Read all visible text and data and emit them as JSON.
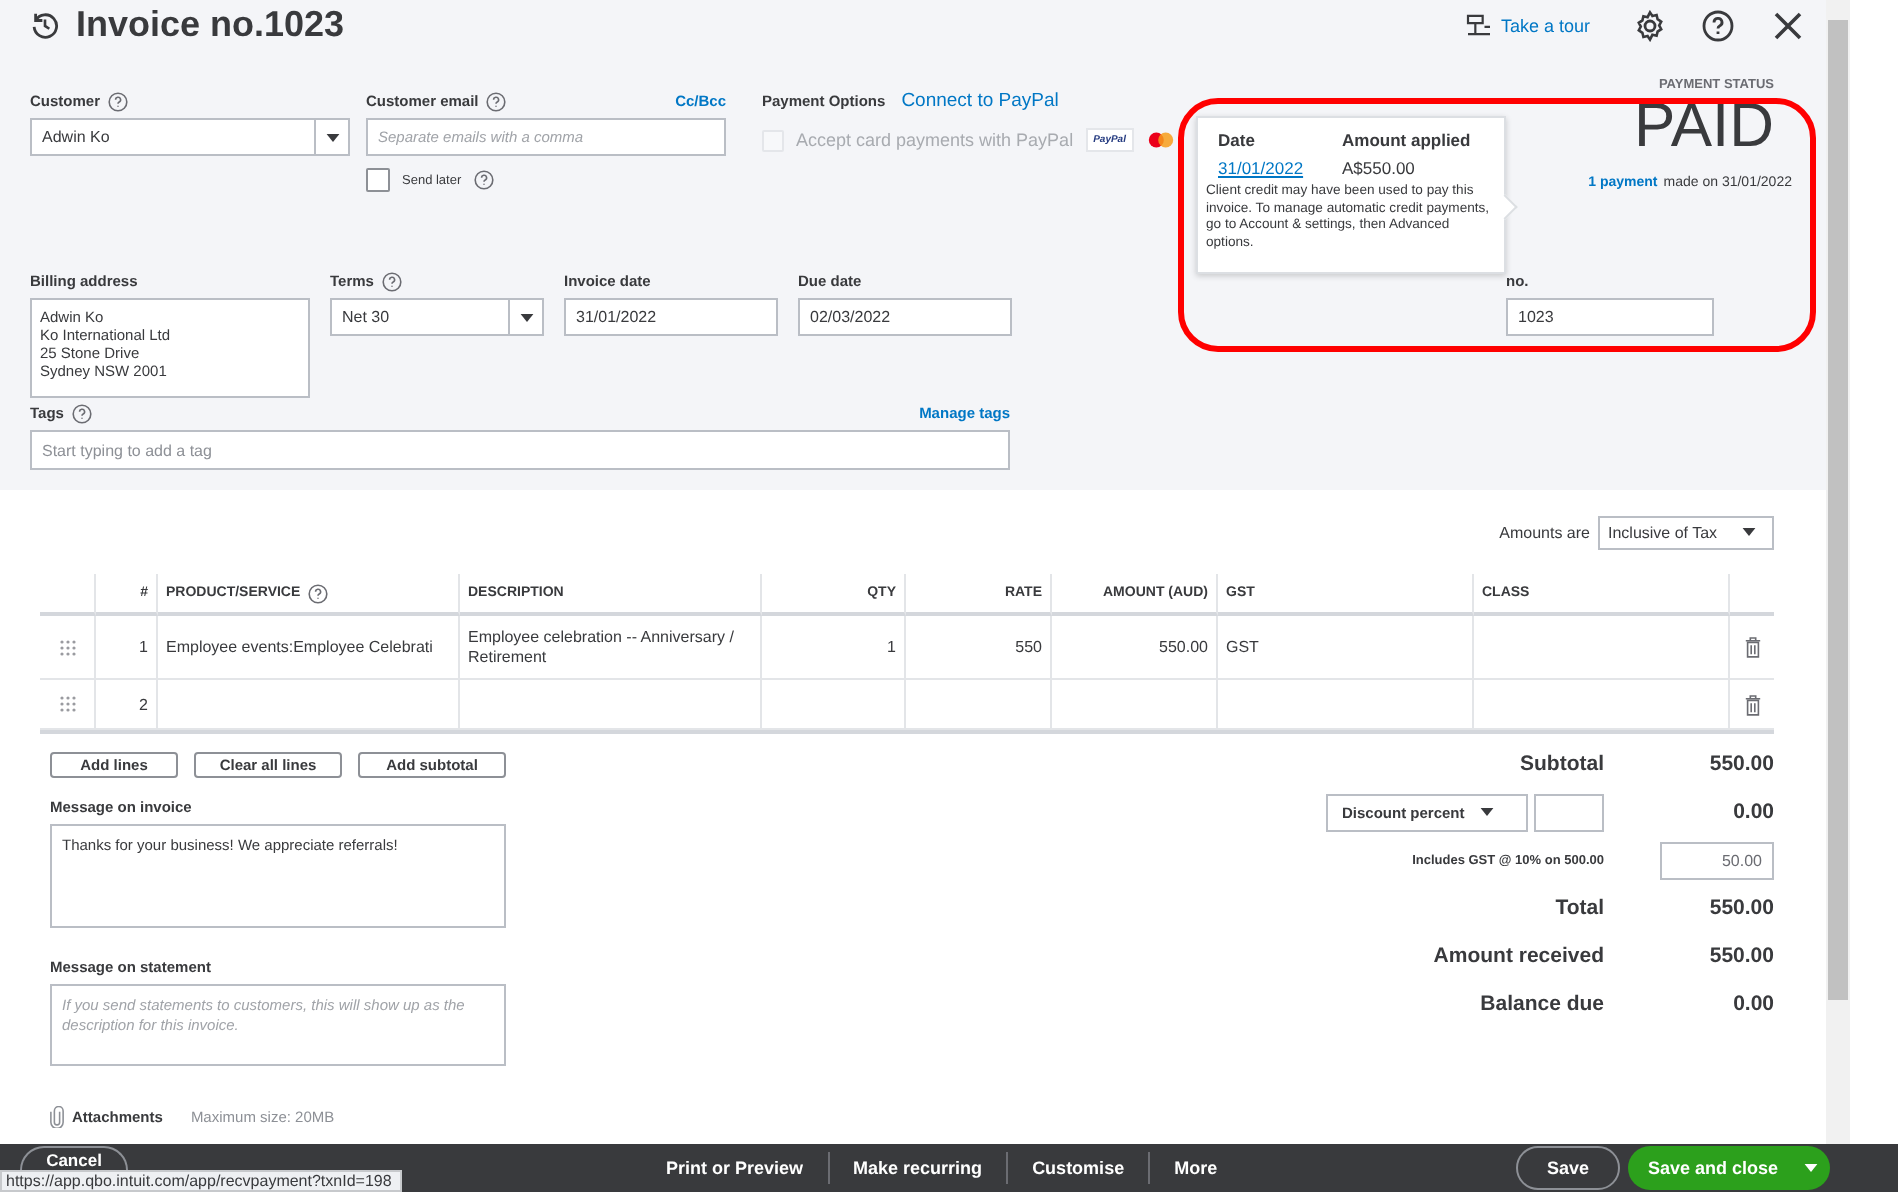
{
  "header": {
    "title": "Invoice no.1023",
    "tour_link": "Take a tour"
  },
  "customer": {
    "label": "Customer",
    "value": "Adwin Ko"
  },
  "customer_email": {
    "label": "Customer email",
    "placeholder": "Separate emails with a comma",
    "cc_link": "Cc/Bcc",
    "send_later": {
      "label": "Send later",
      "checked": false
    }
  },
  "payment_options": {
    "label": "Payment Options",
    "link": "Connect to PayPal",
    "accept_cards": {
      "label": "Accept card payments with PayPal",
      "checked": false,
      "disabled": true
    },
    "paypal_badge": "PayPal"
  },
  "payment_status": {
    "label": "PAYMENT STATUS",
    "status": "PAID",
    "payments_link": "1 payment",
    "payments_note": "made on 31/01/2022"
  },
  "payment_popup": {
    "columns": [
      "Date",
      "Amount applied"
    ],
    "date": "31/01/2022",
    "amount": "A$550.00",
    "note": "Client credit may have been used to pay this invoice. To manage automatic credit payments, go to Account & settings, then Advanced options."
  },
  "billing_address": {
    "label": "Billing address",
    "lines": [
      "Adwin Ko",
      "Ko International Ltd",
      "25 Stone Drive",
      "Sydney NSW  2001"
    ]
  },
  "terms": {
    "label": "Terms",
    "value": "Net 30"
  },
  "invoice_date": {
    "label": "Invoice date",
    "value": "31/01/2022"
  },
  "due_date": {
    "label": "Due date",
    "value": "02/03/2022"
  },
  "invoice_no": {
    "label": "no.",
    "value": "1023"
  },
  "tags": {
    "label": "Tags",
    "placeholder": "Start typing to add a tag",
    "manage_link": "Manage tags"
  },
  "amounts_are": {
    "label": "Amounts are",
    "value": "Inclusive of Tax"
  },
  "table": {
    "columns": [
      "#",
      "PRODUCT/SERVICE",
      "DESCRIPTION",
      "QTY",
      "RATE",
      "AMOUNT (AUD)",
      "GST",
      "CLASS"
    ],
    "rows": [
      {
        "number": "1",
        "product": "Employee events:Employee Celebrati",
        "description": "Employee celebration -- Anniversary / Retirement",
        "qty": "1",
        "rate": "550",
        "amount": "550.00",
        "gst": "GST"
      },
      {
        "number": "2"
      }
    ]
  },
  "line_buttons": [
    "Add lines",
    "Clear all lines",
    "Add subtotal"
  ],
  "message_invoice": {
    "label": "Message on invoice",
    "value": "Thanks for your business!  We appreciate referrals!"
  },
  "message_statement": {
    "label": "Message on statement",
    "placeholder": "If you send statements to customers, this will show up as the description for this invoice."
  },
  "attachments": {
    "label": "Attachments",
    "note": "Maximum size: 20MB"
  },
  "totals": [
    {
      "kind": "plain",
      "label": "Subtotal",
      "value": "550.00"
    },
    {
      "kind": "discount",
      "label": "Discount percent",
      "value": "0.00"
    },
    {
      "kind": "tax",
      "label": "Includes GST @ 10% on 500.00",
      "value": "50.00"
    },
    {
      "kind": "plain",
      "label": "Total",
      "value": "550.00"
    },
    {
      "kind": "plain",
      "label": "Amount received",
      "value": "550.00"
    },
    {
      "kind": "plain",
      "label": "Balance due",
      "value": "0.00"
    }
  ],
  "footer": {
    "cancel": "Cancel",
    "actions": [
      "Print or Preview",
      "Make recurring",
      "Customise",
      "More"
    ],
    "save": "Save",
    "save_close": "Save and close"
  },
  "status_url": "https://app.qbo.intuit.com/app/recvpayment?txnId=198"
}
